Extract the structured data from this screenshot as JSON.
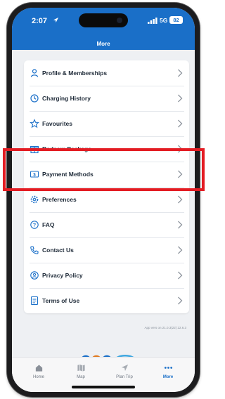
{
  "status": {
    "time": "2:07",
    "network": "5G",
    "battery": "82"
  },
  "header": {
    "title": "More"
  },
  "menu": [
    {
      "label": "Profile & Memberships",
      "icon": "user-icon"
    },
    {
      "label": "Charging History",
      "icon": "history-icon"
    },
    {
      "label": "Favourites",
      "icon": "star-icon"
    },
    {
      "label": "Redeem Package",
      "icon": "gift-icon"
    },
    {
      "label": "Payment Methods",
      "icon": "card-icon"
    },
    {
      "label": "Preferences",
      "icon": "gear-icon"
    },
    {
      "label": "FAQ",
      "icon": "question-icon"
    },
    {
      "label": "Contact Us",
      "icon": "phone-icon"
    },
    {
      "label": "Privacy Policy",
      "icon": "shield-icon"
    },
    {
      "label": "Terms of Use",
      "icon": "document-icon"
    }
  ],
  "app_version": "App vers on 21.0.3(22) 22.6.3",
  "tabs": [
    {
      "label": "Home",
      "icon": "home-icon"
    },
    {
      "label": "Map",
      "icon": "map-icon"
    },
    {
      "label": "Plan Trip",
      "icon": "navigation-icon"
    },
    {
      "label": "More",
      "icon": "more-icon"
    }
  ],
  "colors": {
    "brand": "#1a6fc8",
    "highlight": "#e31c23",
    "text": "#1e2a38"
  }
}
